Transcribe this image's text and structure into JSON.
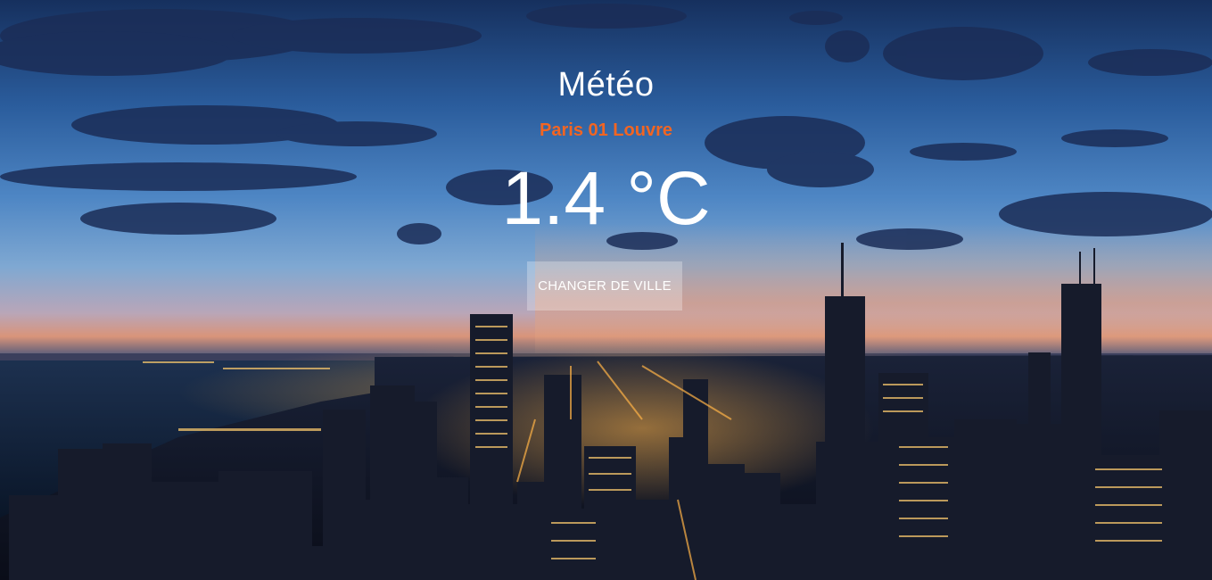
{
  "app": {
    "title": "Météo"
  },
  "weather": {
    "city": "Paris 01 Louvre",
    "temperature": "1.4 °C"
  },
  "actions": {
    "change_city_label": "CHANGER DE VILLE"
  },
  "colors": {
    "accent": "#f26522",
    "text": "#ffffff"
  }
}
